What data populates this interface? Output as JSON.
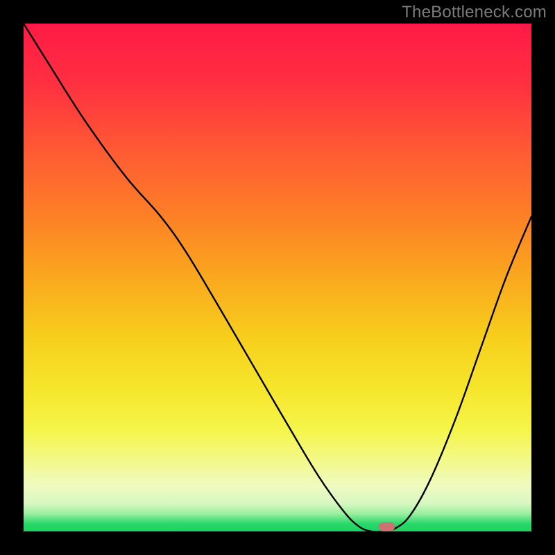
{
  "watermark": "TheBottleneck.com",
  "colors": {
    "frame_bg": "#000000",
    "curve_stroke": "#000000",
    "marker_fill": "#CC7272",
    "gradient_stops": [
      {
        "offset": 0.0,
        "color": "#FF1A46"
      },
      {
        "offset": 0.12,
        "color": "#FF3040"
      },
      {
        "offset": 0.25,
        "color": "#FF5A33"
      },
      {
        "offset": 0.38,
        "color": "#FD8026"
      },
      {
        "offset": 0.5,
        "color": "#FAA81E"
      },
      {
        "offset": 0.62,
        "color": "#F7CF1C"
      },
      {
        "offset": 0.72,
        "color": "#F6E62C"
      },
      {
        "offset": 0.8,
        "color": "#F5F54A"
      },
      {
        "offset": 0.86,
        "color": "#F3F988"
      },
      {
        "offset": 0.91,
        "color": "#EFFAC0"
      },
      {
        "offset": 0.945,
        "color": "#D9F7C2"
      },
      {
        "offset": 0.965,
        "color": "#9BEFA0"
      },
      {
        "offset": 0.985,
        "color": "#28D86A"
      },
      {
        "offset": 1.0,
        "color": "#1ED065"
      }
    ]
  },
  "chart_data": {
    "type": "line",
    "title": "",
    "xlabel": "",
    "ylabel": "",
    "xlim": [
      0,
      100
    ],
    "ylim": [
      0,
      100
    ],
    "x": [
      0,
      5,
      12,
      20,
      27,
      32,
      38,
      45,
      52,
      58,
      63,
      66,
      68.5,
      71,
      73,
      76,
      80,
      85,
      90,
      95,
      100
    ],
    "values": [
      100,
      92,
      81,
      70,
      62,
      55,
      45,
      33,
      21,
      11,
      4,
      1,
      0,
      0,
      0.5,
      3,
      10,
      22,
      36,
      50,
      62
    ],
    "marker": {
      "x": 71.5,
      "width": 3.2,
      "height": 1.8
    }
  }
}
